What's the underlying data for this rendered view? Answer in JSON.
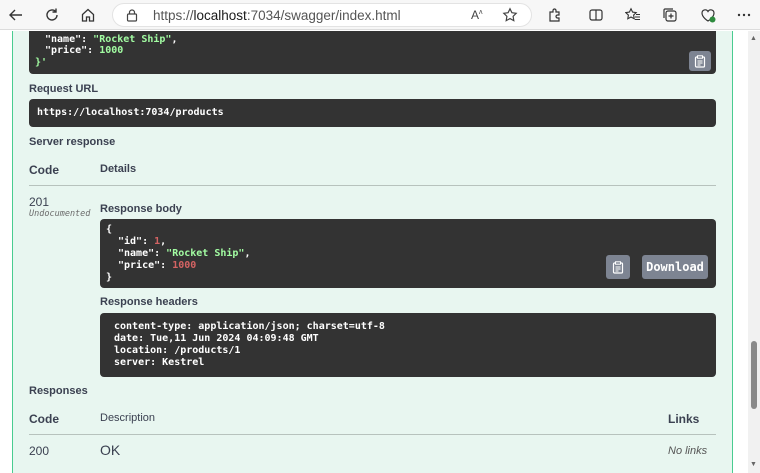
{
  "browser": {
    "url_scheme": "https://",
    "url_host": "localhost",
    "url_rest": ":7034/swagger/index.html"
  },
  "request_body": {
    "line1_key": "\"name\"",
    "line1_val": "\"Rocket Ship\"",
    "line2_key": "\"price\"",
    "line2_val": "1000",
    "line3": "}'"
  },
  "request_url": {
    "label": "Request URL",
    "value": "https://localhost:7034/products"
  },
  "server_response": {
    "label": "Server response",
    "col_code": "Code",
    "col_details": "Details",
    "code": "201",
    "code_note": "Undocumented",
    "body_label": "Response body",
    "body": {
      "open": "{",
      "id_key": "\"id\"",
      "id_val": "1",
      "name_key": "\"name\"",
      "name_val": "\"Rocket Ship\"",
      "price_key": "\"price\"",
      "price_val": "1000",
      "close": "}"
    },
    "download_label": "Download",
    "headers_label": "Response headers",
    "headers": [
      "content-type: application/json; charset=utf-8",
      "date: Tue,11 Jun 2024 04:09:48 GMT",
      "location: /products/1",
      "server: Kestrel"
    ]
  },
  "responses": {
    "label": "Responses",
    "col_code": "Code",
    "col_description": "Description",
    "col_links": "Links",
    "rows": [
      {
        "code": "200",
        "description": "OK",
        "links": "No links"
      }
    ]
  }
}
